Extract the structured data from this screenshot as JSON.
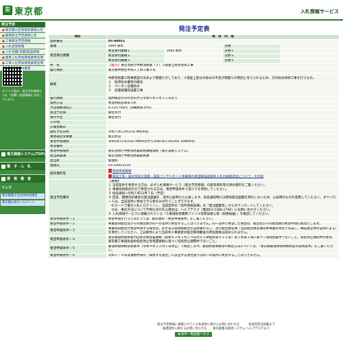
{
  "header": {
    "logo_mark": "東",
    "logo_text": "東京都",
    "system_title": "入札情報サービス"
  },
  "sidebar": {
    "heading": "発注予定",
    "links": [
      "東京都公告情報等業務公告",
      "業務発注予定業務公告",
      "工事発注予定情報",
      "入札結果情報",
      "入札見積(見積)経過情報",
      "業者入札参加資格業者名簿",
      "工事入札参加資格業者名簿",
      "入札参加資格業者"
    ],
    "mobile_text": "モバイル版は、発注予定業務と入札（見積）経過情報に対応しています。",
    "buttons": [
      "電子調達システム(TOP)",
      "電　子　入　札",
      "資　格　審　査"
    ],
    "link_heading": "リンク",
    "ext_links": [
      "東京都電子自治体共同運営",
      "東京都公式ホームページ"
    ]
  },
  "main": {
    "title": "発注予定表",
    "col_item": "項目",
    "col_detail": "項　目　内　容",
    "rows": {
      "contract_no_label": "契約番号",
      "contract_no": "05-00051",
      "category_label": "業種",
      "category": "3900 防水",
      "class_label": "分野",
      "wish_label": "希望受付業種",
      "wish1_label": "希望受付業種１",
      "wish1": "3900 防水",
      "wish2_label": "希望受付業種２",
      "wish3_label": "希望受付業種３",
      "field1": "分野１",
      "field2": "分野２",
      "field3": "分野３",
      "name_label": "件　名",
      "name_tag": "【電子】",
      "name": "東京消防庁中野消防署（５）３階屋上防水改修工事",
      "place_label": "履行場所",
      "place": "東京都中野区中央三丁目２番３号",
      "summary_label": "概要",
      "summary": "中野消防署三階事務室の天井より雨漏りがしており、３階屋上部分の防水の不良が雨漏りの原因と考えられるため、次の防水改修工事を行うもの。\n１　既存防水層等の撤去\n２　ウレタン塗膜防水\n３　床面保護剤設置工事",
      "period_label": "履行期間",
      "period": "契約確定の日の翌日から令和６年３月１１日まで",
      "method_label": "契約方法",
      "method": "希望制指名競争入札",
      "price_label": "予定価格(税込)",
      "price": "4,110,700円（消費税率10%）",
      "f_price_label": "発注予定価",
      "f_price": "随位有付",
      "date_label": "後付予定",
      "date": "随位有付",
      "other_label": "その他",
      "pub_label": "公報登載日",
      "open_label": "開札予定日時",
      "open": "令和５年12月22日 9時30分",
      "rank_label": "業者選定等事業",
      "rank": "経営状況",
      "wish_period_label": "希望申請期間",
      "wish_period": "令和5年11月22日 9時00分から令和5年11月29日 16時00分",
      "wish_note_label": "希望備考",
      "wish_place_label": "希望申請場所",
      "wish_place": "東京消防庁中野消防署総務課経理係（電子調達システム）",
      "dept_label": "担当局部課",
      "dept": "東京消防庁中野消防署総務課",
      "person_label": "担当者",
      "person": "経理係",
      "tel_label": "連絡先",
      "tel": "03-3366-0119",
      "doc_label": "配布資料等",
      "doc1": "希望申請書類",
      "doc2": "建設工事・設計等及び測量・建設コンサルタント等業務の希望制指名競争入札の制度改正について・その他",
      "cond_label": "発注予定備考",
      "cond_head": "【重要】",
      "cond": "１ 当該案件を希望する方は、必ず入札情報サービス（発注予定情報）の配布資料等の添付資料をご覧ください。\n２ 事業協同組合の方で希望される方は、希望申請条件２及び３を参照してください。\n３ 指名通知→令和５年12月７日（予定）\n４ 回答、積算内訳書等の発注図書を、案件公表時から公表します。指名通知時には原則発注図書を添付しないため、公表時のものを使用してください。ダウンロードは、当該案件に参加できる者のみが行うことができます。\n　ICカードで電子入札にログインし、当該案件の「案件情報詳細」の「発注図書等」からダウンロードしてください。\n　なお、事前方法について不明な点がある場合は、ヘルプデスク（電話03-5388-2790）にお問い合わせください。\n５ 入札情報サービスに掲載されている「工事請負等積算ファイル等参加者心得（財務局編）」を確認してください。",
      "wc1_label": "希望申請条件－１",
      "wc1": "希望申請を行うにあたっては、配布資料「希望申請要件」をご覧ください。",
      "wc2_label": "希望申請条件－２",
      "wc2": "事業協同組合及びその組合員が同一の案件に希望することはできません。同一案件に希望した場合は、組合及びその組合員の希望申請を無効とします。",
      "wc3_label": "希望申請条件－３",
      "wc3": "事業協同組合が希望申請する場合は、必ず官公需適格組合の証明書の写し、及び組合員名簿（当該組合員名簿は本事業所単位で作成し、構成員全体の証明による）を添付してください。上記要件により当該中小事業者の経営事項審査の参加資格は認められません。",
      "wc4_label": "希望申請条件－４",
      "wc4": "東京都契約関係暴力団等対策措置要綱（昭和６２年１月１４日付６１財経庶第９２２号）第５条第１項に基づく排除措置中でないこと。指名停止期間中の者等、東京都工事請負契約指名停止等措置要綱に基づく指名停止期間中でないこと。",
      "wc5_label": "希望申請条件－５",
      "wc5": "最低制限価格は新基準（令和４年１２月１日改正）で算定します。最低制限価格等の算定方法については、「東京都最低制限価格制度の運用基準」をご覧ください。",
      "wc6_label": "希望申請条件－６",
      "wc6": "令和５・６年度資格申請の「関係する会社」に該当する会社間では同一の案件に希望することはできません。"
    },
    "back_button": "◀ 案件一覧画面へ戻る"
  },
  "footer": {
    "line1": "発注予定情報に掲載されている各案件に関するお問い合わせ先　　　各局所担当部署まで",
    "line2": "調達案件に関するお問い合わせ先　　東京都電子調達システム ヘルプデスクまで"
  }
}
